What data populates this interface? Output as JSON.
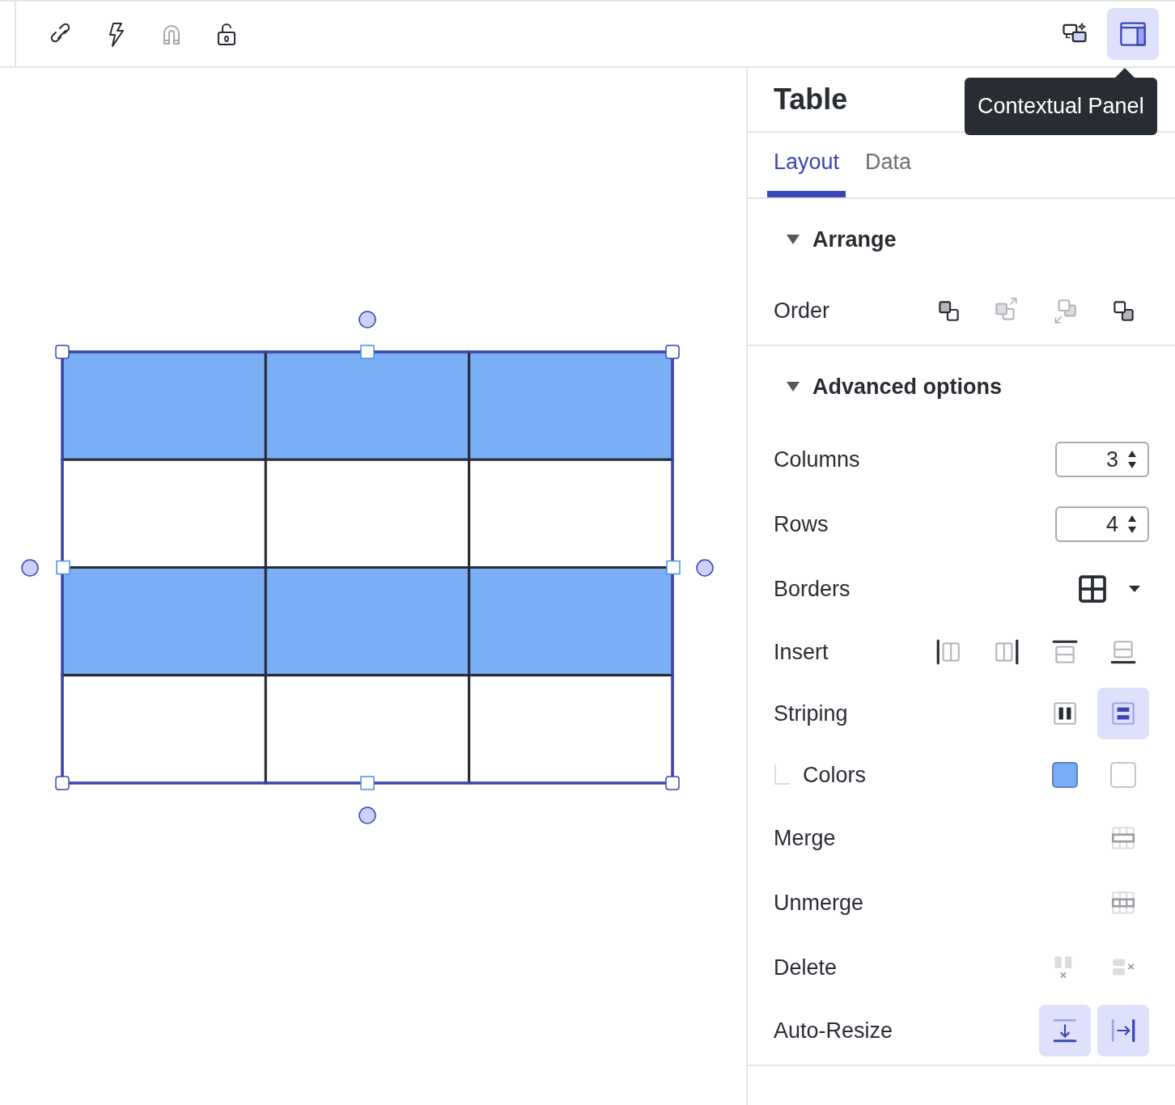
{
  "toolbar": {
    "left_tools": [
      {
        "kind": "link",
        "disabled": false
      },
      {
        "kind": "bolt",
        "disabled": false
      },
      {
        "kind": "magnet",
        "disabled": true
      },
      {
        "kind": "lock",
        "disabled": false
      }
    ],
    "right_tools": [
      {
        "kind": "chat",
        "selected": false
      },
      {
        "kind": "panel",
        "selected": true
      }
    ]
  },
  "tooltip": {
    "text": "Contextual Panel"
  },
  "canvas": {
    "table": {
      "rows": [
        {
          "striped": true
        },
        {
          "striped": false
        },
        {
          "striped": true
        },
        {
          "striped": false
        }
      ]
    }
  },
  "panel": {
    "title": "Table",
    "tabs": [
      {
        "label": "Layout",
        "selected": true
      },
      {
        "label": "Data",
        "selected": false
      }
    ],
    "sections": [
      {
        "title": "Arrange",
        "expanded": true,
        "rows": [
          {
            "kind": "icons",
            "label": "Order",
            "buttons": [
              {
                "kind": "front",
                "disabled": false
              },
              {
                "kind": "forward",
                "disabled": true
              },
              {
                "kind": "backward",
                "disabled": true
              },
              {
                "kind": "back",
                "disabled": false
              }
            ]
          }
        ]
      },
      {
        "title": "Advanced options",
        "expanded": true,
        "rows": [
          {
            "kind": "stepper",
            "label": "Columns",
            "value": "3"
          },
          {
            "kind": "stepper",
            "label": "Rows",
            "value": "4"
          },
          {
            "kind": "dropdown",
            "label": "Borders"
          },
          {
            "kind": "icons",
            "label": "Insert",
            "buttons": [
              {
                "kind": "colleft",
                "disabled": false
              },
              {
                "kind": "colright",
                "disabled": false
              },
              {
                "kind": "rowabove",
                "disabled": false
              },
              {
                "kind": "rowbelow",
                "disabled": false
              }
            ]
          },
          {
            "kind": "toggles",
            "label": "Striping",
            "buttons": [
              {
                "kind": "stripecols",
                "selected": false
              },
              {
                "kind": "striperows",
                "selected": true
              }
            ]
          },
          {
            "kind": "swatches",
            "label": "Colors",
            "swatches": [
              {
                "color": "#7aaef5"
              },
              {
                "color": "#ffffff"
              }
            ]
          },
          {
            "kind": "icons",
            "label": "Merge",
            "buttons": [
              {
                "kind": "merge",
                "disabled": true
              }
            ]
          },
          {
            "kind": "icons",
            "label": "Unmerge",
            "buttons": [
              {
                "kind": "unmerge",
                "disabled": true
              }
            ]
          },
          {
            "kind": "icons",
            "label": "Delete",
            "buttons": [
              {
                "kind": "delcol",
                "disabled": true
              },
              {
                "kind": "delrow",
                "disabled": true
              }
            ]
          },
          {
            "kind": "toggles",
            "label": "Auto-Resize",
            "buttons": [
              {
                "kind": "fitheight",
                "selected": true
              },
              {
                "kind": "fitwidth",
                "selected": true
              }
            ]
          }
        ]
      }
    ]
  }
}
